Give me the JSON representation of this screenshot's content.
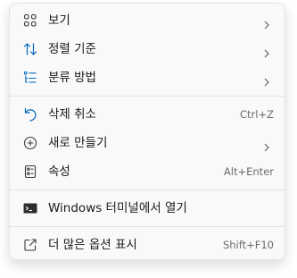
{
  "context_menu": {
    "items": [
      {
        "id": "view",
        "label": "보기",
        "icon": "grid-icon",
        "submenu": true
      },
      {
        "id": "sort",
        "label": "정렬 기준",
        "icon": "sort-arrows-icon",
        "submenu": true
      },
      {
        "id": "group",
        "label": "분류 방법",
        "icon": "list-group-icon",
        "submenu": true
      },
      {
        "id": "undo",
        "label": "삭제 취소",
        "icon": "undo-icon",
        "shortcut": "Ctrl+Z"
      },
      {
        "id": "new",
        "label": "새로 만들기",
        "icon": "add-circle-icon",
        "submenu": true
      },
      {
        "id": "properties",
        "label": "속성",
        "icon": "properties-icon",
        "shortcut": "Alt+Enter"
      },
      {
        "id": "terminal",
        "label": "Windows 터미널에서 열기",
        "icon": "terminal-icon"
      },
      {
        "id": "more",
        "label": "더 많은 옵션 표시",
        "icon": "open-external-icon",
        "shortcut": "Shift+F10"
      }
    ]
  },
  "colors": {
    "menu_background": "#f9f9f9",
    "accent": "#0067c0",
    "text": "#1b1b1b",
    "shortcut_text": "#6b6b6b"
  }
}
